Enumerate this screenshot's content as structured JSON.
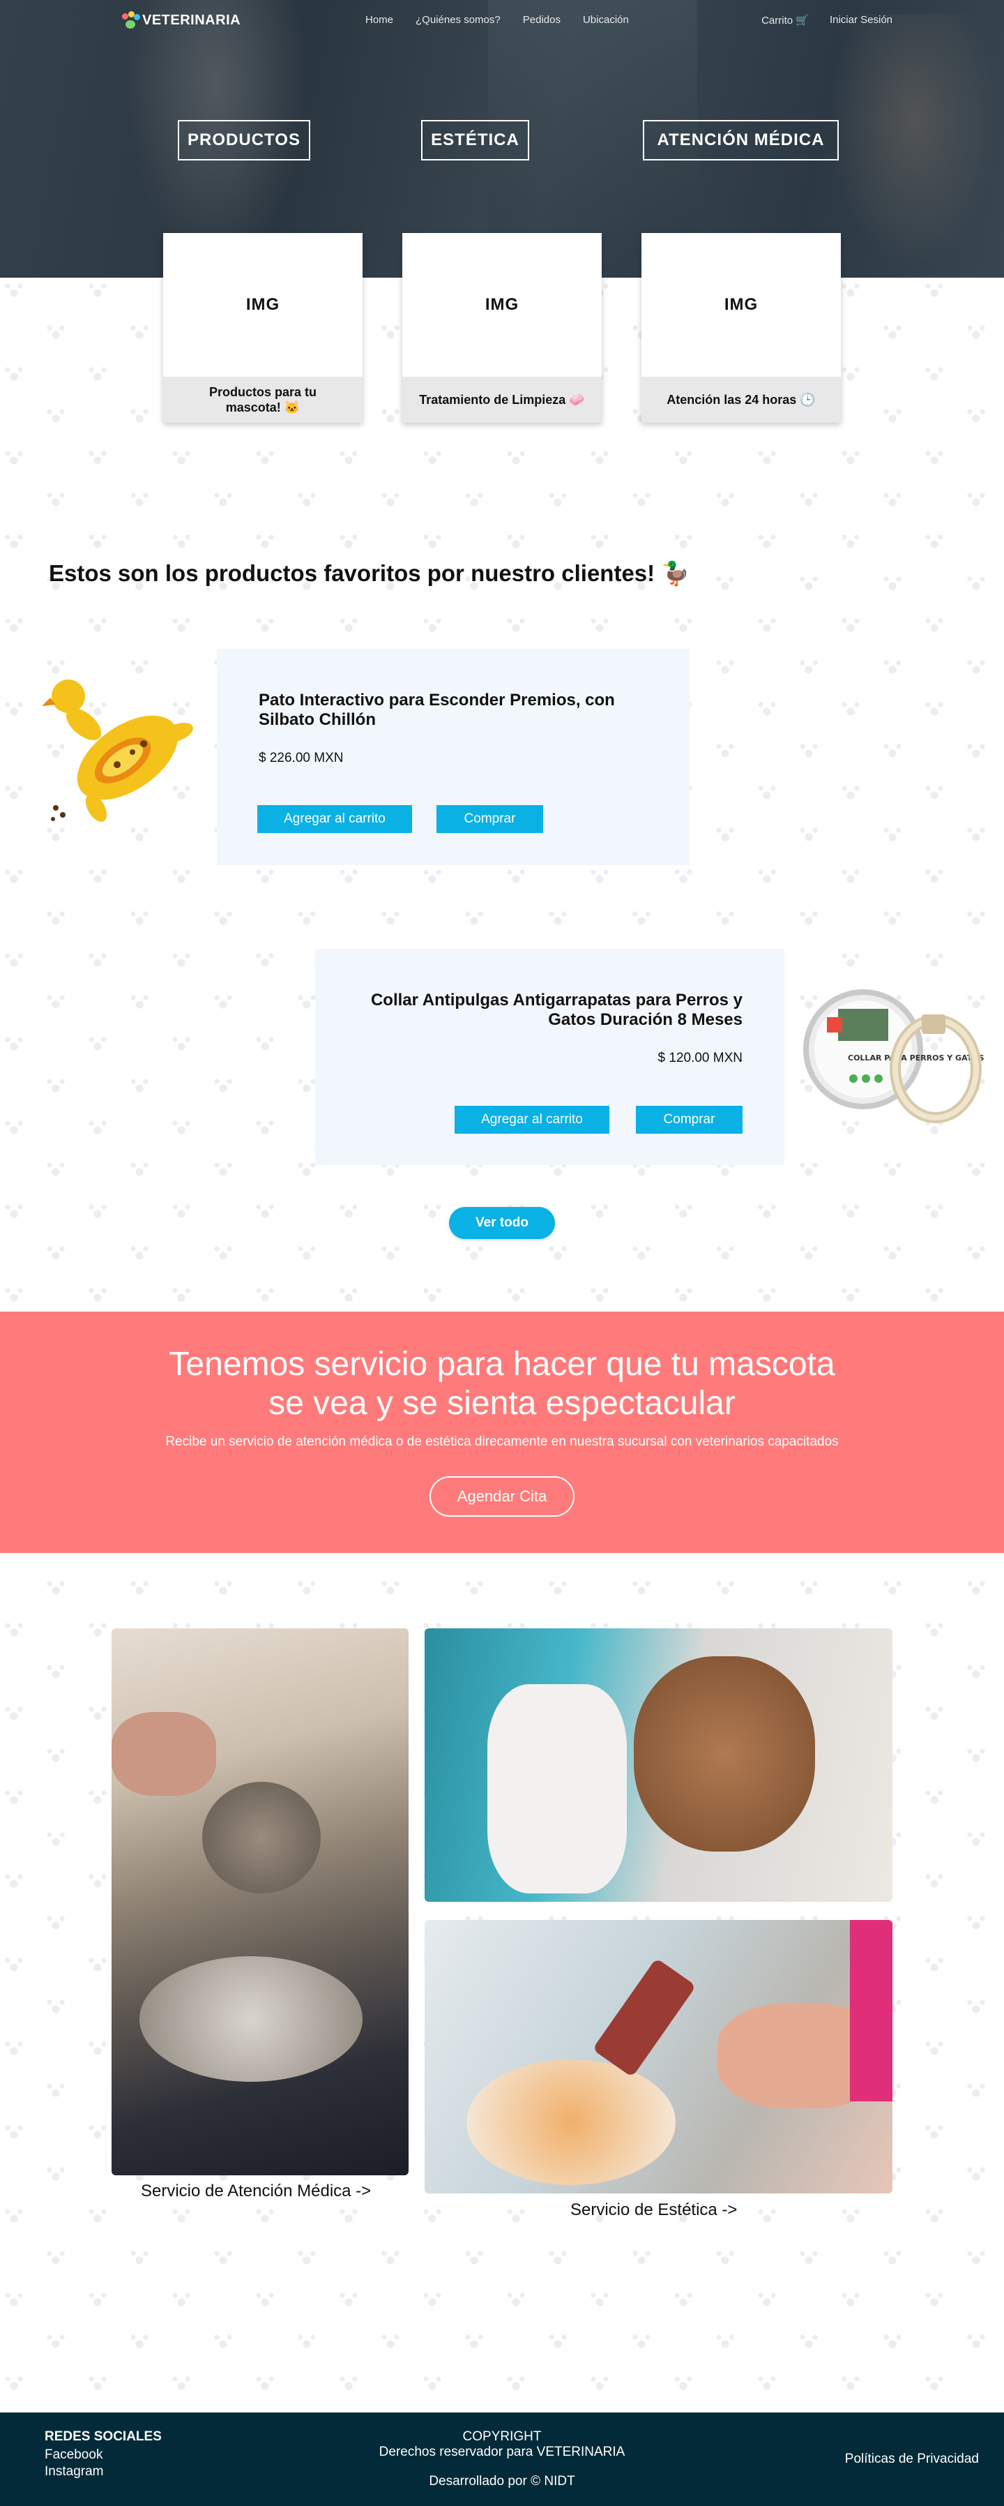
{
  "brand": {
    "name": "VETERINARIA"
  },
  "nav": {
    "links": [
      "Home",
      "¿Quiénes somos?",
      "Pedidos",
      "Ubicación"
    ],
    "cart": "Carrito 🛒",
    "login": "Iniciar Sesión"
  },
  "hero": {
    "buttons": [
      "PRODUCTOS",
      "ESTÉTICA",
      "ATENCIÓN MÉDICA"
    ]
  },
  "service_cards": [
    {
      "img": "IMG",
      "caption": "Productos para tu mascota! 🐱"
    },
    {
      "img": "IMG",
      "caption": "Tratamiento de Limpieza 🧼"
    },
    {
      "img": "IMG",
      "caption": "Atención las 24 horas 🕒"
    }
  ],
  "favorites": {
    "title": "Estos son los productos  favoritos por nuestro clientes! 🦆",
    "products": [
      {
        "name": "Pato Interactivo para Esconder Premios, con Silbato Chillón",
        "price": "$ 226.00 MXN",
        "add_label": "Agregar al carrito",
        "buy_label": "Comprar"
      },
      {
        "name": "Collar Antipulgas Antigarrapatas para Perros y Gatos Duración 8 Meses",
        "price": "$ 120.00 MXN",
        "add_label": "Agregar al carrito",
        "buy_label": "Comprar"
      }
    ],
    "collar_package_text": "COLLAR PARA PERROS Y GATOS",
    "view_all": "Ver todo"
  },
  "promo": {
    "title_line1": "Tenemos servicio para hacer que tu mascota",
    "title_line2": "se vea y se sienta espectacular",
    "subtitle": "Recibe un  servicio de atención médica o de estética direcamente en nuestra sucursal con veterinarios capacitados",
    "cta": "Agendar Cita"
  },
  "gallery": {
    "medical_caption": "Servicio de Atención Médica ->",
    "aesthetic_caption": "Servicio de Estética ->"
  },
  "footer": {
    "social_title": "REDES SOCIALES",
    "facebook": "Facebook",
    "instagram": "Instagram",
    "copyright_title": "COPYRIGHT",
    "copyright_text": "Derechos reservador para VETERINARIA",
    "developed": "Desarrollado por © NIDT",
    "privacy": "Políticas de Privacidad"
  },
  "colors": {
    "accent": "#0ab1e4",
    "promo": "#ff7b7b",
    "footer": "#022a38",
    "product_bg": "#f2f7fd"
  }
}
